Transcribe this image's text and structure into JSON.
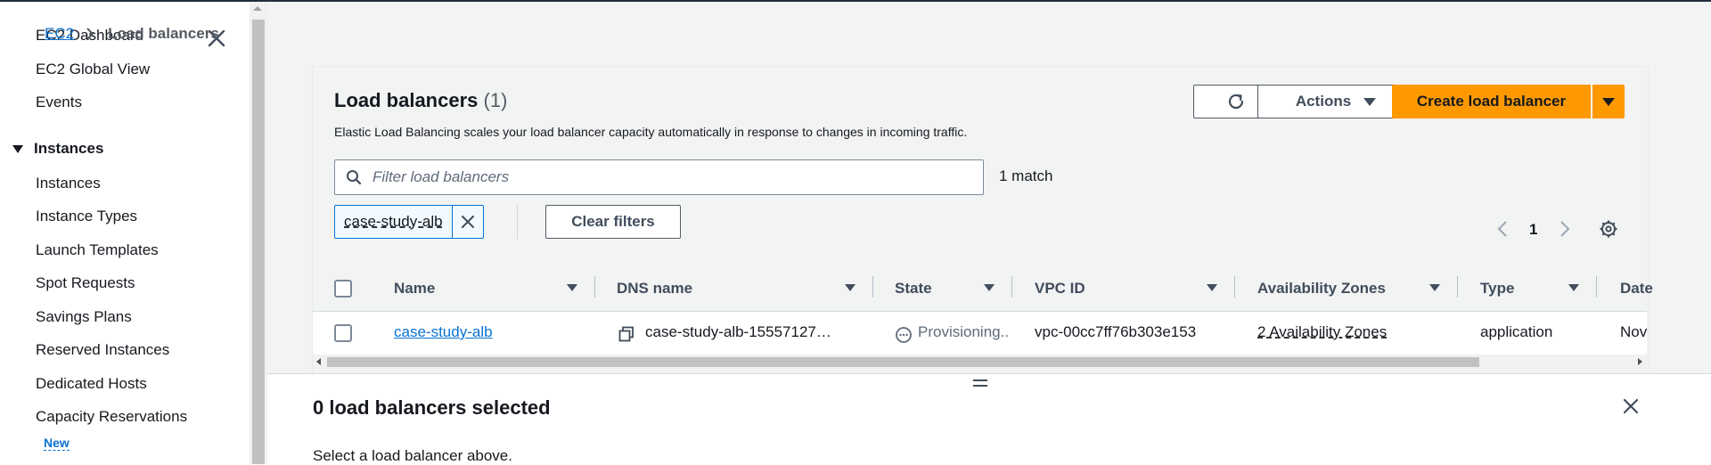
{
  "sidebar": {
    "items": [
      {
        "label": "EC2 Dashboard"
      },
      {
        "label": "EC2 Global View"
      },
      {
        "label": "Events"
      }
    ],
    "section": {
      "label": "Instances"
    },
    "section_items": [
      {
        "label": "Instances"
      },
      {
        "label": "Instance Types"
      },
      {
        "label": "Launch Templates"
      },
      {
        "label": "Spot Requests"
      },
      {
        "label": "Savings Plans"
      },
      {
        "label": "Reserved Instances"
      },
      {
        "label": "Dedicated Hosts"
      },
      {
        "label": "Capacity Reservations"
      }
    ],
    "new_badge": "New"
  },
  "breadcrumb": {
    "root": "EC2",
    "current": "Load balancers"
  },
  "panel": {
    "title": "Load balancers",
    "count": "(1)",
    "description": "Elastic Load Balancing scales your load balancer capacity automatically in response to changes in incoming traffic.",
    "actions_label": "Actions",
    "create_label": "Create load balancer",
    "filter_placeholder": "Filter load balancers",
    "match_text": "1 match",
    "filter_token": "case-study-alb",
    "clear_filters_label": "Clear filters",
    "page_number": "1"
  },
  "table": {
    "columns": [
      "Name",
      "DNS name",
      "State",
      "VPC ID",
      "Availability Zones",
      "Type",
      "Date"
    ],
    "rows": [
      {
        "name": "case-study-alb",
        "dns_name": "case-study-alb-15557127…",
        "state": "Provisioning..",
        "vpc_id": "vpc-00cc7ff76b303e153",
        "availability_zones": "2 Availability Zones",
        "type": "application",
        "date": "Nov"
      }
    ]
  },
  "split_panel": {
    "title": "0 load balancers selected",
    "description": "Select a load balancer above."
  },
  "colors": {
    "accent": "#ff9900",
    "link": "#0972d3",
    "background": "#f2f3f3"
  },
  "icons": [
    "close-icon",
    "chevron-right-icon",
    "refresh-icon",
    "caret-down-icon",
    "search-icon",
    "chevron-left-icon",
    "gear-icon",
    "copy-icon",
    "status-pending-icon",
    "drag-handle-icon"
  ]
}
